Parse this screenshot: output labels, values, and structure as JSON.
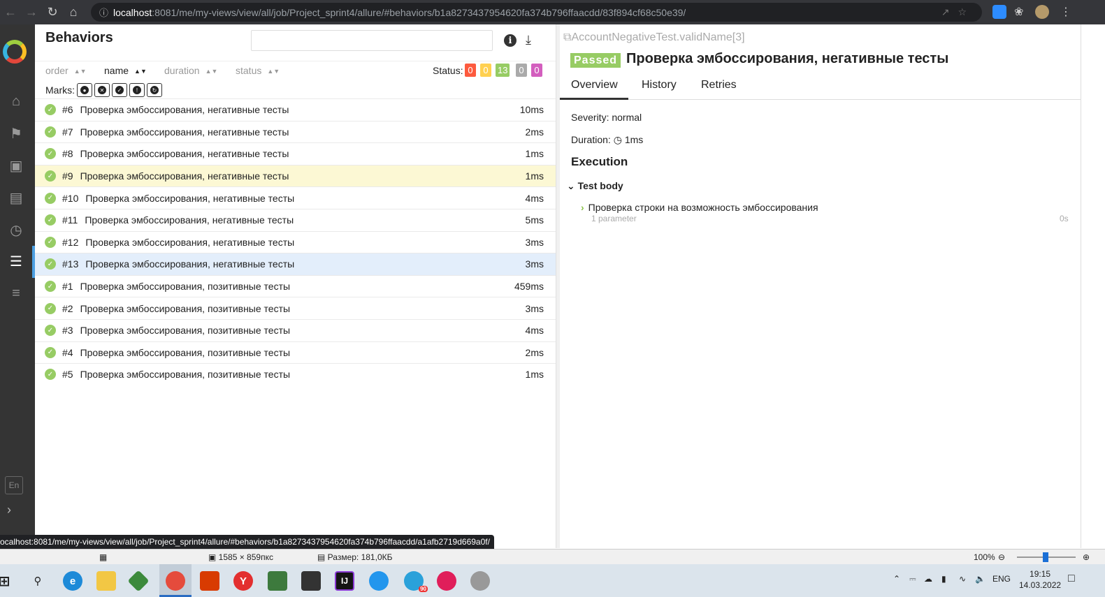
{
  "browser": {
    "url_host": "localhost",
    "url_rest": ":8081/me/my-views/view/all/job/Project_sprint4/allure/#behaviors/b1a8273437954620fa374b796ffaacdd/83f894cf68c50e39/",
    "hover_url": "ocalhost:8081/me/my-views/view/all/job/Project_sprint4/allure/#behaviors/b1a8273437954620fa374b796ffaacdd/a1afb2719d669a0f/"
  },
  "sidebar": {
    "lang": "En"
  },
  "left": {
    "title": "Behaviors",
    "sort": {
      "order": "order",
      "name": "name",
      "duration": "duration",
      "status": "status"
    },
    "status_label": "Status:",
    "status_counts": [
      {
        "value": "0",
        "color": "#fd5a3e"
      },
      {
        "value": "0",
        "color": "#ffd050"
      },
      {
        "value": "13",
        "color": "#97cc64"
      },
      {
        "value": "0",
        "color": "#aaaaaa"
      },
      {
        "value": "0",
        "color": "#d35ebe"
      }
    ],
    "marks_label": "Marks:",
    "rows": [
      {
        "num": "#6",
        "name": "Проверка эмбоссирования, негативные тесты",
        "duration": "10ms"
      },
      {
        "num": "#7",
        "name": "Проверка эмбоссирования, негативные тесты",
        "duration": "2ms"
      },
      {
        "num": "#8",
        "name": "Проверка эмбоссирования, негативные тесты",
        "duration": "1ms"
      },
      {
        "num": "#9",
        "name": "Проверка эмбоссирования, негативные тесты",
        "duration": "1ms"
      },
      {
        "num": "#10",
        "name": "Проверка эмбоссирования, негативные тесты",
        "duration": "4ms"
      },
      {
        "num": "#11",
        "name": "Проверка эмбоссирования, негативные тесты",
        "duration": "5ms"
      },
      {
        "num": "#12",
        "name": "Проверка эмбоссирования, негативные тесты",
        "duration": "3ms"
      },
      {
        "num": "#13",
        "name": "Проверка эмбоссирования, негативные тесты",
        "duration": "3ms"
      },
      {
        "num": "#1",
        "name": "Проверка эмбоссирования, позитивные тесты",
        "duration": "459ms"
      },
      {
        "num": "#2",
        "name": "Проверка эмбоссирования, позитивные тесты",
        "duration": "3ms"
      },
      {
        "num": "#3",
        "name": "Проверка эмбоссирования, позитивные тесты",
        "duration": "4ms"
      },
      {
        "num": "#4",
        "name": "Проверка эмбоссирования, позитивные тесты",
        "duration": "2ms"
      },
      {
        "num": "#5",
        "name": "Проверка эмбоссирования, позитивные тесты",
        "duration": "1ms"
      }
    ]
  },
  "right": {
    "full_name": "AccountNegativeTest.validName[3]",
    "status": "Passed",
    "title": "Проверка эмбоссирования, негативные тесты",
    "tabs": [
      "Overview",
      "History",
      "Retries"
    ],
    "severity": "Severity: normal",
    "duration_label": "Duration:",
    "duration_value": "1ms",
    "execution": "Execution",
    "test_body": "Test body",
    "step_name": "Проверка строки на возможность эмбоссирования",
    "step_param": "1 parameter",
    "step_duration": "0s"
  },
  "viewer": {
    "dimensions": "1585 × 859пкс",
    "size": "Размер: 181,0КБ",
    "zoom": "100%"
  },
  "taskbar": {
    "lang": "ENG",
    "time": "19:15",
    "date": "14.03.2022",
    "telegram_badge": "90"
  }
}
